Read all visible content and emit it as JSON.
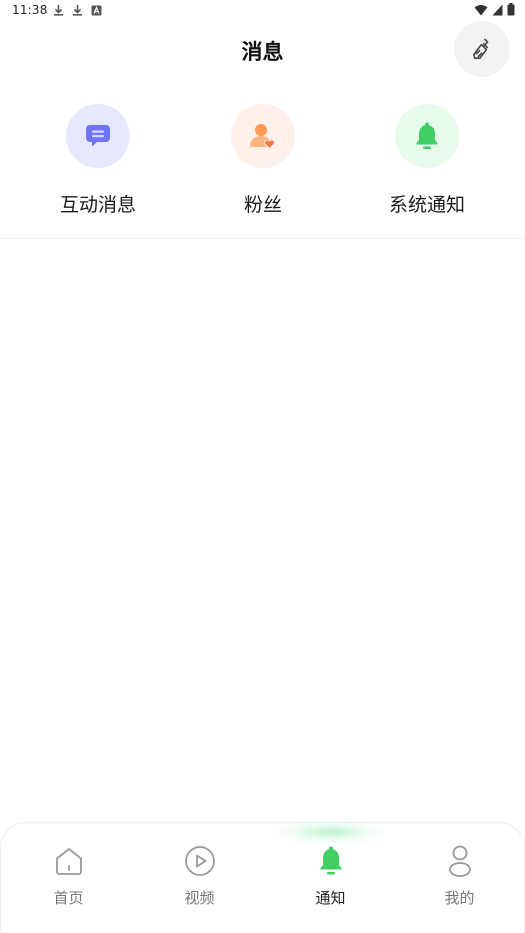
{
  "status_bar": {
    "time": "11:38",
    "left_icons": [
      "download-icon",
      "download-icon",
      "keyboard-a-icon"
    ],
    "right_icons": [
      "wifi-icon",
      "signal-icon",
      "battery-icon"
    ]
  },
  "header": {
    "title": "消息",
    "clean_icon": "broom-icon"
  },
  "categories": [
    {
      "label": "互动消息",
      "icon": "chat-bubble-icon",
      "bg_color": "#e6e8ff",
      "icon_color": "#6f74f2"
    },
    {
      "label": "粉丝",
      "icon": "user-heart-icon",
      "bg_color": "#fff0ea",
      "icon_color": "#ff9a56"
    },
    {
      "label": "系统通知",
      "icon": "bell-icon",
      "bg_color": "#e6fbe9",
      "icon_color": "#3fcf63"
    }
  ],
  "bottom_nav": {
    "items": [
      {
        "label": "首页",
        "icon": "home-icon"
      },
      {
        "label": "视频",
        "icon": "play-icon"
      },
      {
        "label": "通知",
        "icon": "bell-icon",
        "active": true
      },
      {
        "label": "我的",
        "icon": "user-icon"
      }
    ],
    "active_color": "#3fcf63",
    "inactive_color": "#999999"
  }
}
